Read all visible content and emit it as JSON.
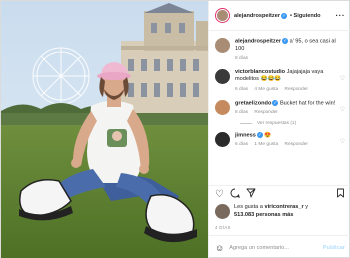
{
  "post": {
    "username": "alejandrospeitzer",
    "follow_status": "Siguiendo",
    "more_icon": "more-dots-icon"
  },
  "comments": [
    {
      "user": "alejandrospeitzer",
      "text": "a' 95, o sea casi al 100",
      "time": "8 días",
      "likes": "",
      "reply": ""
    },
    {
      "user": "victorblancostudio",
      "text": "Jajajajaja vaya modelitos 😂😂😂",
      "time": "6 días",
      "likes": "4 Me gusta",
      "reply": "Responder"
    },
    {
      "user": "gretaelizondo",
      "text": "Bucket hat for the win!",
      "time": "8 días",
      "likes": "",
      "reply": "Responder"
    },
    {
      "user": "jimness",
      "text": "😍",
      "time": "6 días",
      "likes": "1 Me gusta",
      "reply": "Responder"
    }
  ],
  "view_replies": "Ver respuestas (1)",
  "likes": {
    "line1_prefix": "Les gusta a ",
    "line1_user": "viricontreras_r",
    "line1_suffix": " y",
    "count": "513.083 personas más"
  },
  "date": "4 DÍAS",
  "add_comment": {
    "placeholder": "Agrega un comentario...",
    "publish": "Publicar"
  },
  "colors": {
    "link": "#3897f0",
    "publish_disabled": "#b2dffc",
    "meta_gray": "#8e8e8e"
  }
}
